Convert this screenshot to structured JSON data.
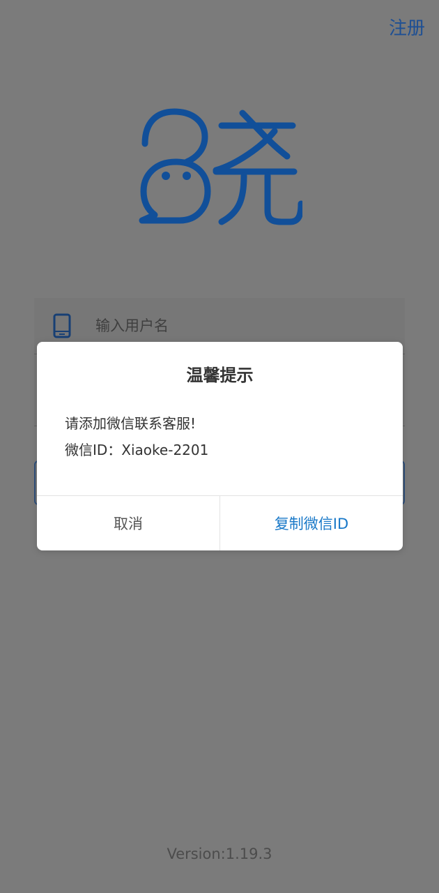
{
  "header": {
    "register_label": "注册"
  },
  "logo": {
    "name": "xiao-logo",
    "color": "#114f99"
  },
  "form": {
    "username_placeholder": "输入用户名"
  },
  "dialog": {
    "title": "温馨提示",
    "message_line1": "请添加微信联系客服!",
    "message_line2": "微信ID：Xiaoke-2201",
    "cancel_label": "取消",
    "copy_label": "复制微信ID"
  },
  "footer": {
    "version": "Version:1.19.3"
  },
  "colors": {
    "brand": "#1d4f94",
    "link_blue": "#1878c8",
    "backdrop": "#7b7b7b"
  }
}
